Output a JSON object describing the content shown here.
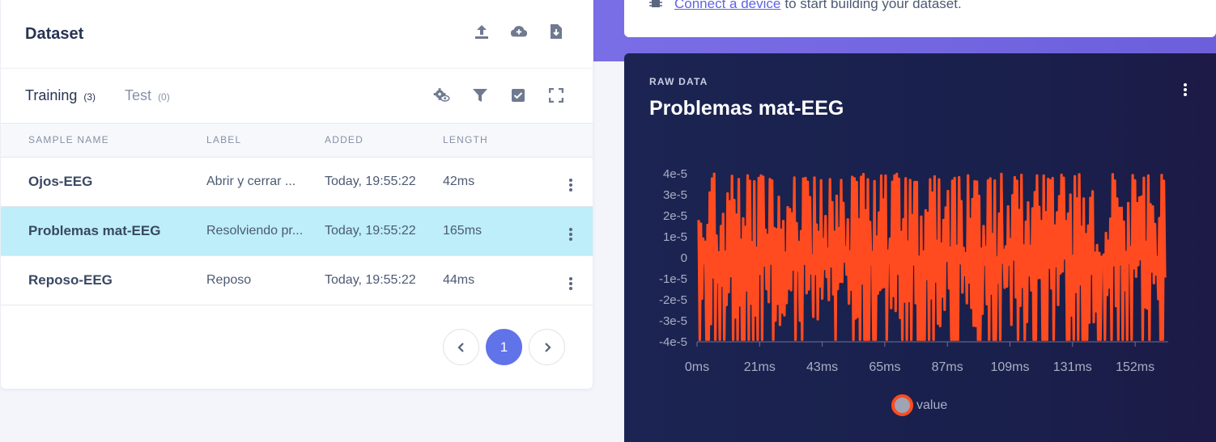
{
  "dataset": {
    "title": "Dataset",
    "header_icons": [
      "upload-icon",
      "cloud-add-icon",
      "download-file-icon"
    ],
    "tabs": [
      {
        "label": "Training",
        "count": "(3)"
      },
      {
        "label": "Test",
        "count": "(0)"
      }
    ],
    "toolbar_icons": [
      "settings-eye-icon",
      "filter-icon",
      "checkbox-icon",
      "expand-icon"
    ],
    "columns": [
      "SAMPLE NAME",
      "LABEL",
      "ADDED",
      "LENGTH"
    ],
    "rows": [
      {
        "name": "Ojos-EEG",
        "label": "Abrir y cerrar ...",
        "added": "Today, 19:55:22",
        "length": "42ms"
      },
      {
        "name": "Problemas mat-EEG",
        "label": "Resolviendo pr...",
        "added": "Today, 19:55:22",
        "length": "165ms"
      },
      {
        "name": "Reposo-EEG",
        "label": "Reposo",
        "added": "Today, 19:55:22",
        "length": "44ms"
      }
    ],
    "pagination": {
      "current": "1"
    }
  },
  "message": {
    "link_text": "Connect a device",
    "rest_text": "to start building your dataset."
  },
  "raw": {
    "subtitle": "RAW DATA",
    "title": "Problemas mat-EEG"
  },
  "chart_data": {
    "type": "line",
    "title": "Problemas mat-EEG",
    "y_ticks": [
      "4e-5",
      "3e-5",
      "2e-5",
      "1e-5",
      "0",
      "-1e-5",
      "-2e-5",
      "-3e-5",
      "-4e-5"
    ],
    "x_ticks": [
      "0ms",
      "21ms",
      "43ms",
      "65ms",
      "87ms",
      "109ms",
      "131ms",
      "152ms"
    ],
    "ylim": [
      -4e-05,
      4e-05
    ],
    "xlim": [
      0,
      165
    ],
    "series": [
      {
        "name": "value",
        "color": "#ff4b1f"
      }
    ],
    "legend": "bottom-center"
  },
  "colors": {
    "accent": "#6073e8",
    "selected_row": "#bdeef9",
    "series": "#ff4b1f",
    "dark_panel": "#1b2452"
  }
}
